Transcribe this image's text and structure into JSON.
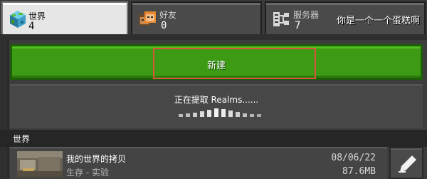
{
  "tabs": [
    {
      "label": "世界",
      "count": "4",
      "icon": "globe-icon",
      "active": true
    },
    {
      "label": "好友",
      "count": "0",
      "icon": "friends-icon",
      "active": false
    },
    {
      "label": "服务器",
      "count": "7",
      "icon": "servers-icon",
      "active": false
    }
  ],
  "server_name": "你是一个一个蛋糕啊",
  "create_button": {
    "label": "新建"
  },
  "realms": {
    "status_text": "正在提取 Realms......"
  },
  "worlds_section": {
    "header": "世界"
  },
  "worlds": [
    {
      "name": "我的世界的拷贝",
      "mode": "生存 - 实验",
      "date": "08/06/22",
      "size": "87.6MB"
    }
  ],
  "colors": {
    "create_green": "#3c9a14",
    "highlight": "#d8563b",
    "panel": "#3c3c3c"
  },
  "edit_icon": "pencil-icon"
}
